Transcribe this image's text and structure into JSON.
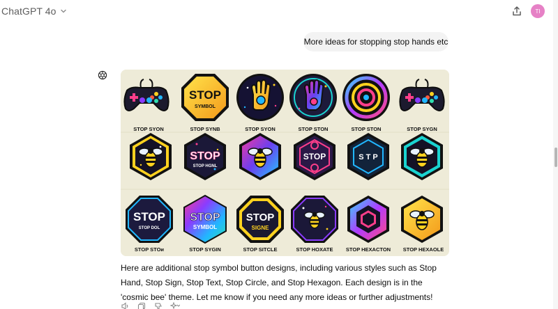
{
  "header": {
    "model_name": "ChatGPT 4o",
    "avatar_initials": "TI",
    "avatar_color": "#e681c6"
  },
  "user_message": {
    "text": "More ideas for stopping stop hands etc"
  },
  "assistant": {
    "image": {
      "background": "#eeebd8",
      "rows": [
        [
          "STOP SYON",
          "STOP SYNB",
          "STOP SYON",
          "STOP STON",
          "STOP STON",
          "STOP SYGN"
        ],
        [
          "",
          "",
          "",
          "",
          "",
          ""
        ],
        [
          "STOP STOᴎ",
          "STOP SYGIN",
          "STOP SITCLE",
          "STOP HOXATE",
          "STOP HEXACTON",
          "STOP HEXAOLE"
        ]
      ],
      "emblem_texts": {
        "stop": "STOP",
        "symbol": "SYMBOL",
        "stop_hgnl": "STOP HGNL",
        "stop_dol": "STOP DOL",
        "signe": "SIGNE",
        "s_t_p": "S T P"
      }
    },
    "response": "Here are additional stop symbol button designs, including various styles such as Stop Hand, Stop Sign, Stop Text, Stop Circle, and Stop Hexagon. Each design is in the 'cosmic bee' theme. Let me know if you need any more ideas or further adjustments!"
  }
}
